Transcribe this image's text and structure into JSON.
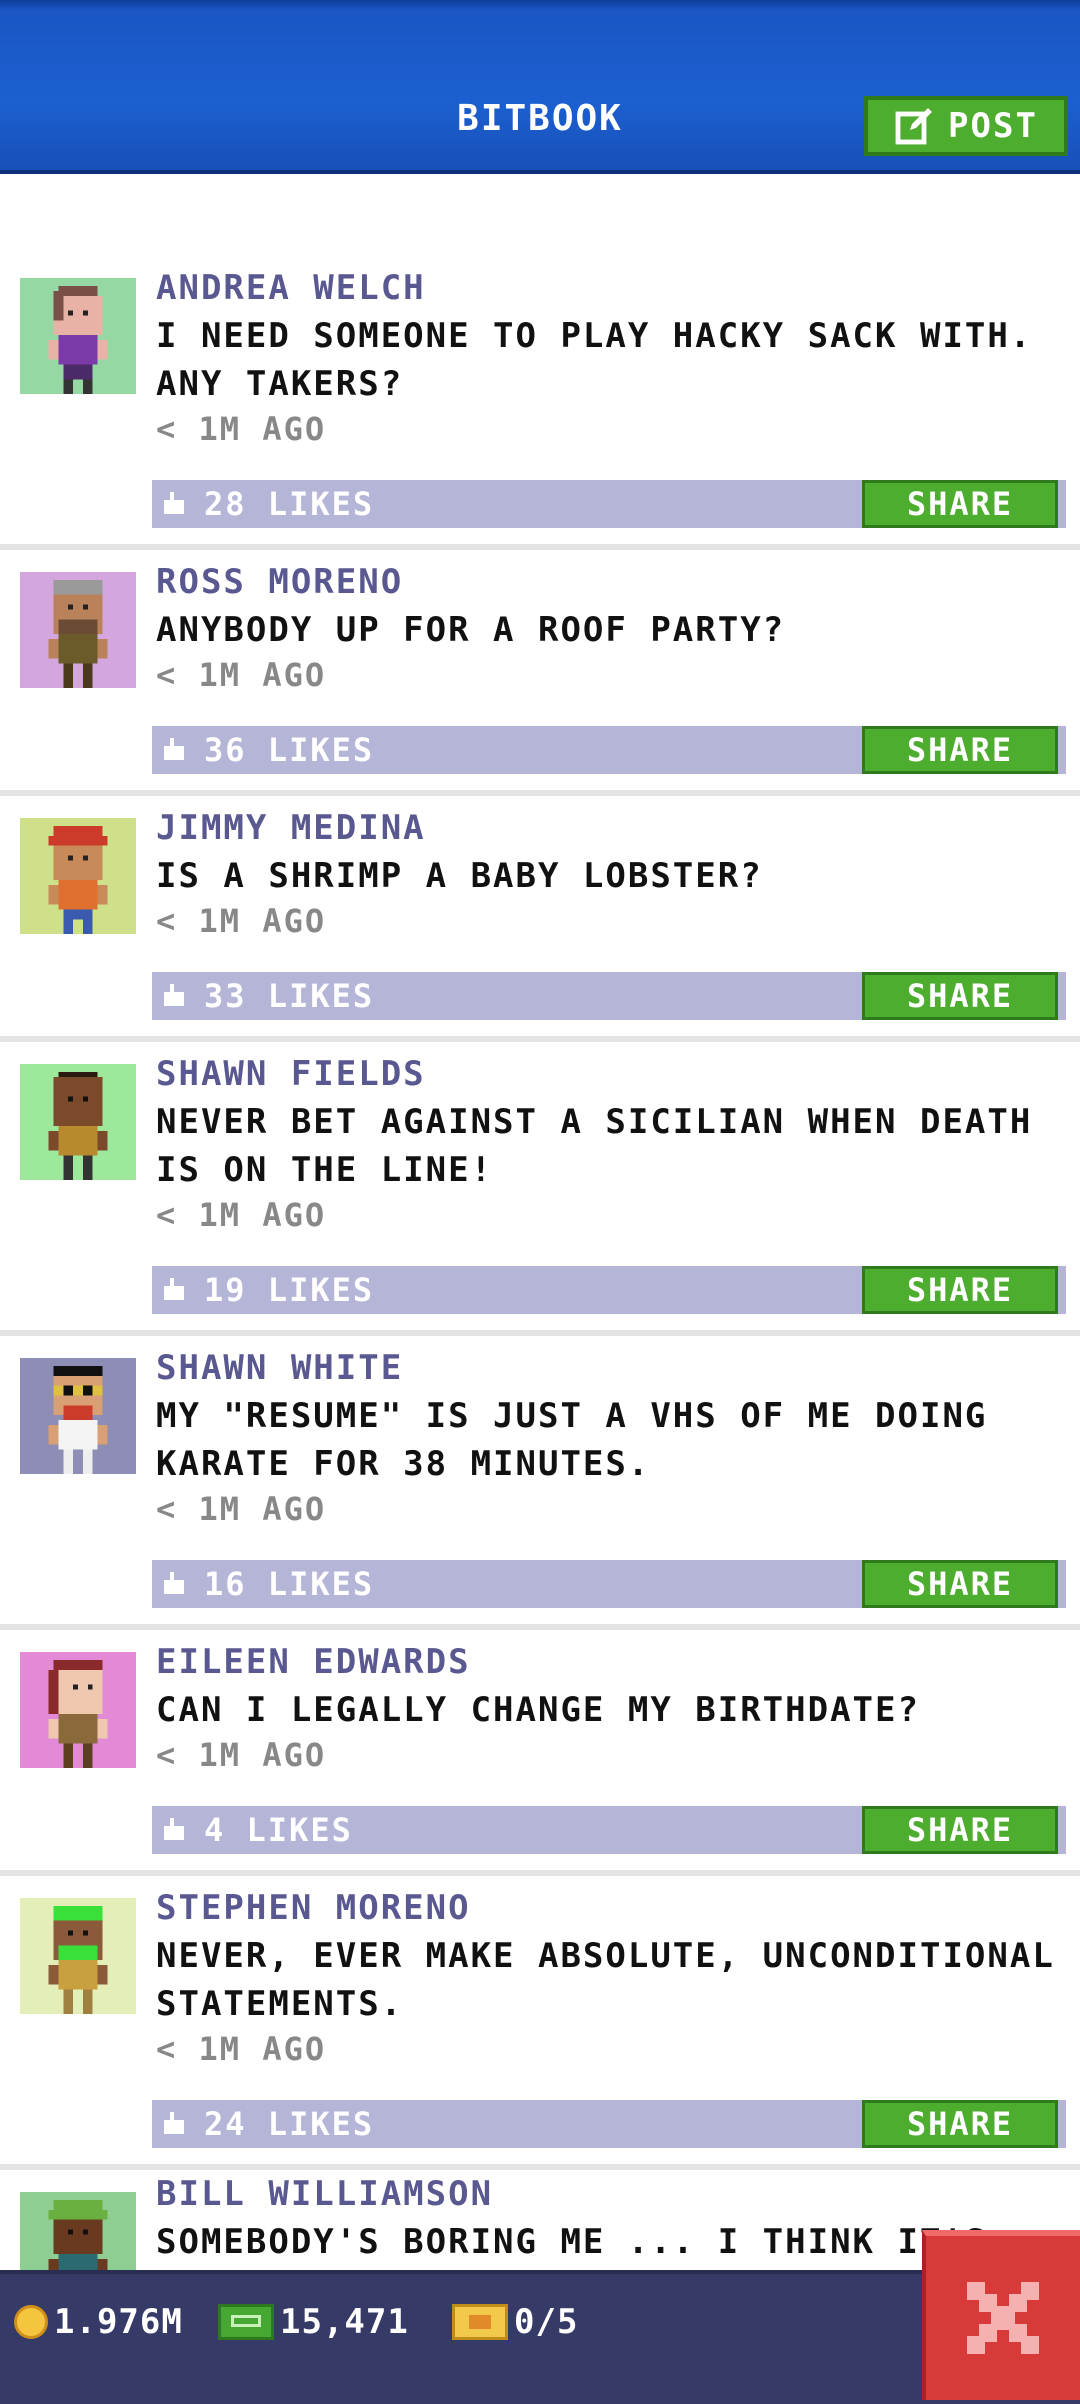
{
  "header": {
    "title": "BITBOOK",
    "post_label": "POST"
  },
  "posts": [
    {
      "name": "ANDREA WELCH",
      "text": "I NEED SOMEONE TO PLAY HACKY SACK WITH. ANY TAKERS?",
      "time": "< 1M AGO",
      "likes": "28 LIKES",
      "share": "SHARE",
      "avatar_bg": "#96d8a4"
    },
    {
      "name": "ROSS MORENO",
      "text": "ANYBODY UP FOR A ROOF PARTY?",
      "time": "< 1M AGO",
      "likes": "36 LIKES",
      "share": "SHARE",
      "avatar_bg": "#d3a7de"
    },
    {
      "name": "JIMMY MEDINA",
      "text": "IS A SHRIMP A BABY LOBSTER?",
      "time": "< 1M AGO",
      "likes": "33 LIKES",
      "share": "SHARE",
      "avatar_bg": "#cfe08a"
    },
    {
      "name": "SHAWN FIELDS",
      "text": "NEVER BET AGAINST A SICILIAN WHEN DEATH IS ON THE LINE!",
      "time": "< 1M AGO",
      "likes": "19 LIKES",
      "share": "SHARE",
      "avatar_bg": "#9de89a"
    },
    {
      "name": "SHAWN WHITE",
      "text": "MY \"RESUME\" IS JUST A VHS OF ME DOING KARATE FOR 38 MINUTES.",
      "time": "< 1M AGO",
      "likes": "16 LIKES",
      "share": "SHARE",
      "avatar_bg": "#8d8db5"
    },
    {
      "name": "EILEEN EDWARDS",
      "text": "CAN I LEGALLY CHANGE MY BIRTHDATE?",
      "time": "< 1M AGO",
      "likes": "4 LIKES",
      "share": "SHARE",
      "avatar_bg": "#e38ad6"
    },
    {
      "name": "STEPHEN MORENO",
      "text": "NEVER, EVER MAKE ABSOLUTE, UNCONDITIONAL STATEMENTS.",
      "time": "< 1M AGO",
      "likes": "24 LIKES",
      "share": "SHARE",
      "avatar_bg": "#e3eeb8"
    },
    {
      "name": "BILL WILLIAMSON",
      "text": "SOMEBODY'S BORING ME ... I THINK IT'S",
      "avatar_bg": "#8fce92"
    }
  ],
  "bottom_bar": {
    "coins": "1.976M",
    "bux": "15,471",
    "tickets": "0/5"
  },
  "colors": {
    "header": "#1c5fd0",
    "accent_green": "#4cad2f",
    "likes_bar": "#b5b5d8",
    "name_text": "#5a5890",
    "close_red": "#d83a3a"
  }
}
